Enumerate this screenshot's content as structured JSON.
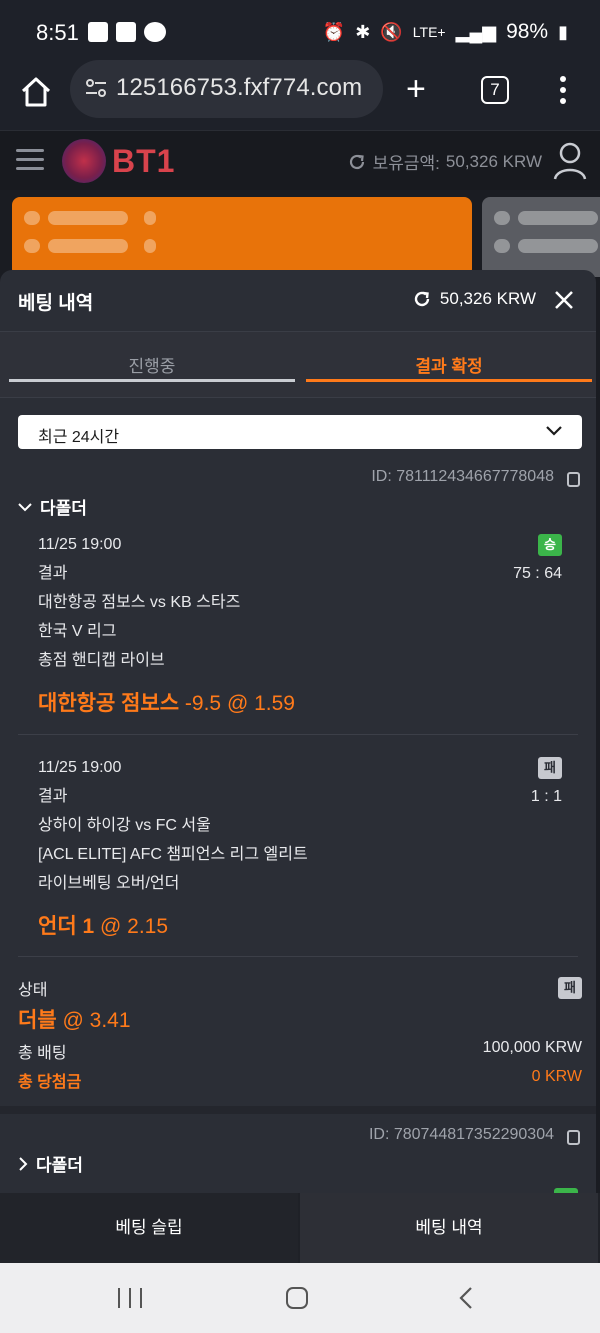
{
  "status_bar": {
    "time": "8:51",
    "network": "LTE+",
    "battery": "98%"
  },
  "browser": {
    "url": "125166753.fxf774.com",
    "tab_count": "7"
  },
  "site": {
    "logo_text": "BT1",
    "balance_label": "보유금액:",
    "balance_value": "50,326 KRW"
  },
  "panel": {
    "title": "베팅 내역",
    "balance": "50,326 KRW",
    "tabs": [
      {
        "label": "진행중",
        "active": false
      },
      {
        "label": "결과 확정",
        "active": true
      }
    ],
    "period_select": "최근 24시간",
    "bets": [
      {
        "id": "ID: 781112434667778048",
        "type": "다폴더",
        "legs": [
          {
            "datetime": "11/25 19:00",
            "result_label": "결과",
            "score": "75 : 64",
            "badge": "승",
            "match": "대한항공 점보스 vs KB 스타즈",
            "league": "한국 V 리그",
            "market": "총점 핸디캡 라이브",
            "pick": "대한항공 점보스",
            "odds_text": "-9.5 @ 1.59"
          },
          {
            "datetime": "11/25 19:00",
            "result_label": "결과",
            "score": "1 : 1",
            "badge": "패",
            "match": "상하이 하이강 vs FC 서울",
            "league": "[ACL ELITE] AFC 챔피언스 리그 엘리트",
            "market": "라이브베팅 오버/언더",
            "pick": "언더 1",
            "odds_text": "@ 2.15"
          }
        ],
        "status_label": "상태",
        "status_badge": "패",
        "combo_name": "더블",
        "combo_odds": "@ 3.41",
        "total_bet_label": "총 배팅",
        "total_bet_value": "100,000 KRW",
        "total_win_label": "총 당첨금",
        "total_win_value": "0 KRW"
      },
      {
        "id": "ID: 780744817352290304",
        "type": "다폴더"
      }
    ]
  },
  "bottom_tabs": {
    "slip": "베팅 슬립",
    "history": "베팅 내역"
  },
  "colors": {
    "accent": "#ff7a1a",
    "win_badge": "#3bb54a",
    "panel_bg": "#2b2e36"
  }
}
